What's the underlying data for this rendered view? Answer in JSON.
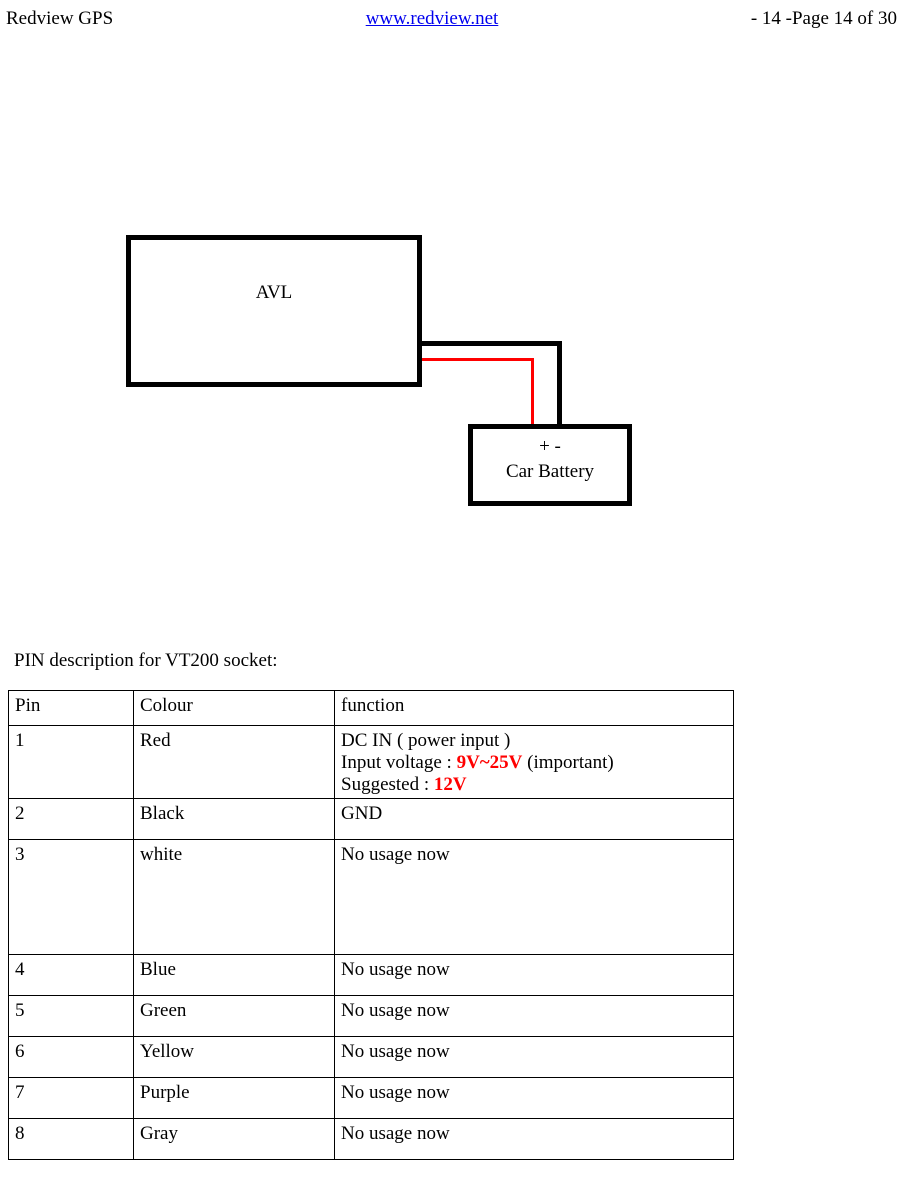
{
  "header": {
    "left": "Redview GPS",
    "center_link": "www.redview.net",
    "right": "- 14 -Page 14 of 30"
  },
  "diagram": {
    "avl_label": "AVL",
    "battery_polarity": "+    -",
    "battery_label": "Car Battery"
  },
  "caption": "PIN description for VT200 socket:",
  "table": {
    "headers": {
      "pin": "Pin",
      "colour": "Colour",
      "function": "function"
    },
    "rows": [
      {
        "pin": "1",
        "colour": "Red",
        "function_line1": "DC IN ( power input )",
        "function_line2_a": "Input voltage : ",
        "function_line2_b": "9V~25V",
        "function_line2_c": " (important)",
        "function_line3_a": "Suggested : ",
        "function_line3_b": "12V",
        "tall": false
      },
      {
        "pin": "2",
        "colour": "Black",
        "function_plain": "GND",
        "tall": false
      },
      {
        "pin": "3",
        "colour": "white",
        "function_plain": "No usage now",
        "tall": true
      },
      {
        "pin": "4",
        "colour": "Blue",
        "function_plain": "No usage now",
        "tall": false
      },
      {
        "pin": "5",
        "colour": "Green",
        "function_plain": "No usage now",
        "tall": false
      },
      {
        "pin": "6",
        "colour": "Yellow",
        "function_plain": "No usage now",
        "tall": false
      },
      {
        "pin": "7",
        "colour": "Purple",
        "function_plain": "No usage now",
        "tall": false
      },
      {
        "pin": "8",
        "colour": "Gray",
        "function_plain": "No usage now",
        "tall": false
      }
    ]
  }
}
